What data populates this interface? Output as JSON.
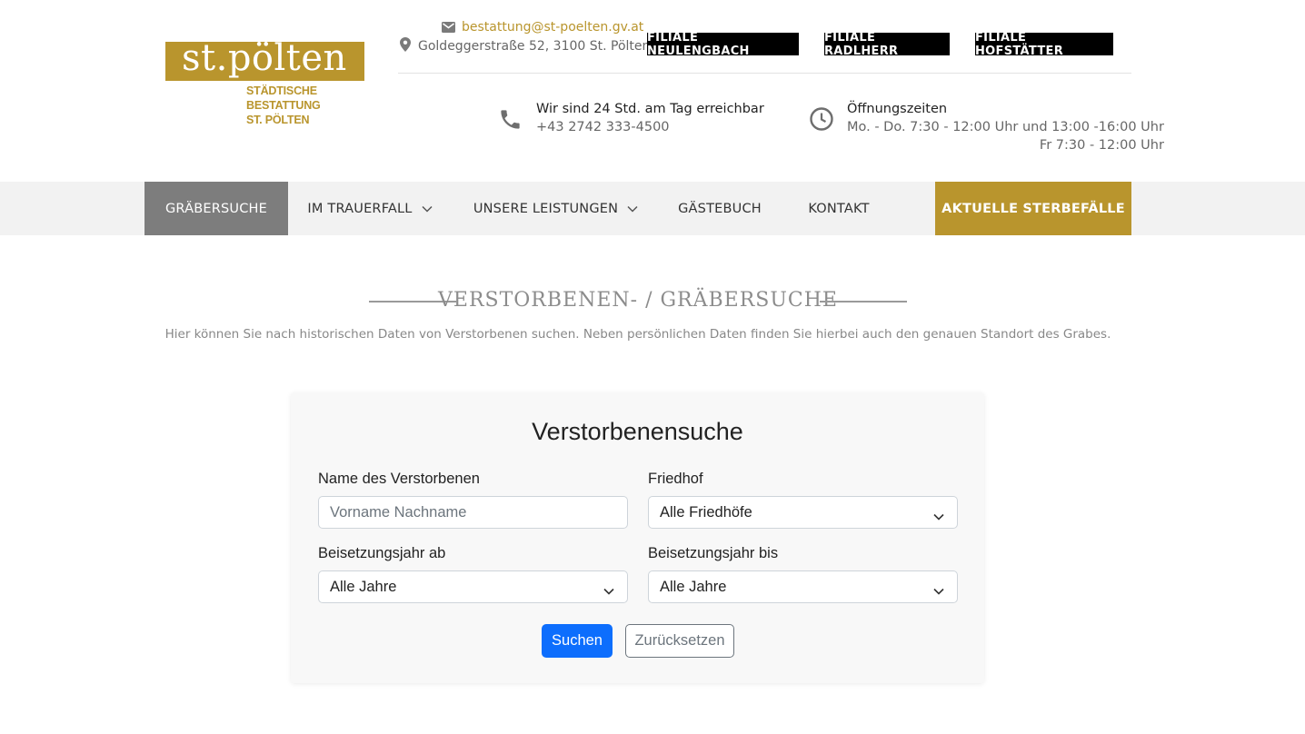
{
  "header": {
    "logo": {
      "name": "st.pölten",
      "sub_line1": "STÄDTISCHE BESTATTUNG",
      "sub_line2": "ST. PÖLTEN"
    },
    "email": "bestattung@st-poelten.gv.at",
    "address": "Goldeggerstraße 52, 3100 St. Pölten",
    "branches": [
      "FILIALE NEULENGBACH",
      "FILIALE RADLHERR",
      "FILIALE HOFSTÄTTER"
    ],
    "phone": {
      "line1": "Wir sind 24 Std. am Tag erreichbar",
      "line2": "+43 2742 333-4500"
    },
    "hours": {
      "title": "Öffnungszeiten",
      "line1": "Mo. - Do. 7:30 - 12:00 Uhr und 13:00 -16:00 Uhr",
      "line2": "Fr 7:30 - 12:00 Uhr"
    }
  },
  "nav": {
    "items": [
      {
        "label": "GRÄBERSUCHE"
      },
      {
        "label": "IM TRAUERFALL"
      },
      {
        "label": "UNSERE LEISTUNGEN"
      },
      {
        "label": "GÄSTEBUCH"
      },
      {
        "label": "KONTAKT"
      },
      {
        "label": "AKTUELLE STERBEFÄLLE"
      }
    ]
  },
  "section": {
    "title": "VERSTORBENEN- / GRÄBERSUCHE",
    "description": "Hier können Sie nach historischen Daten von Verstorbenen suchen. Neben persönlichen Daten finden Sie hierbei auch den genauen Standort des Grabes."
  },
  "search_form": {
    "title": "Verstorbenensuche",
    "name_label": "Name des Verstorbenen",
    "name_placeholder": "Vorname Nachname",
    "cemetery_label": "Friedhof",
    "cemetery_value": "Alle Friedhöfe",
    "year_from_label": "Beisetzungsjahr ab",
    "year_from_value": "Alle Jahre",
    "year_to_label": "Beisetzungsjahr bis",
    "year_to_value": "Alle Jahre",
    "search_button": "Suchen",
    "reset_button": "Zurücksetzen"
  },
  "colors": {
    "brand_gold": "#b9952d",
    "primary_blue": "#0d6efd",
    "nav_active": "#7d7d7d",
    "nav_bg": "#f2f2f2"
  }
}
